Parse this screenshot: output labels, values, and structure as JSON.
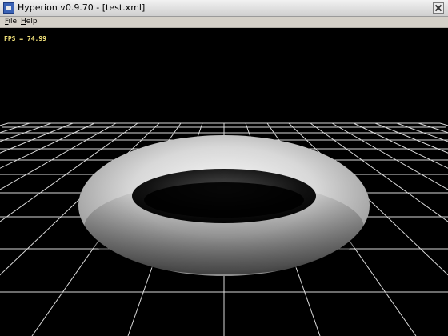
{
  "window": {
    "title": "Hyperion v0.9.70 - [test.xml]"
  },
  "menu": {
    "file": {
      "mnemonic": "F",
      "rest": "ile"
    },
    "help": {
      "mnemonic": "H",
      "rest": "elp"
    }
  },
  "viewport": {
    "fps_text": "FPS = 74.99",
    "background_color": "#000000",
    "grid_color": "#ffffff",
    "object": "torus"
  }
}
